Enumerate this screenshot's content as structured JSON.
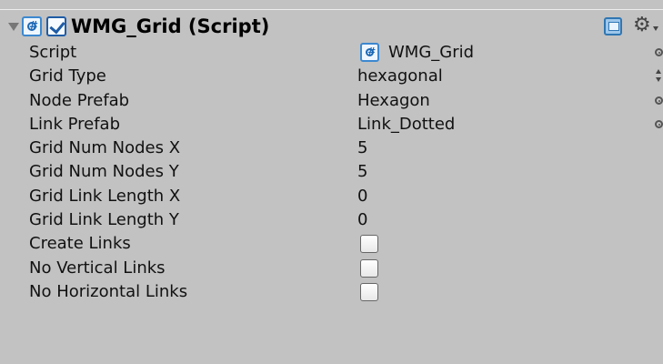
{
  "component": {
    "title": "WMG_Grid (Script)",
    "enabled": true,
    "icons": {
      "foldout": "foldout-expanded-icon",
      "script": "script-icon",
      "help": "help-icon",
      "settings": "gear-icon"
    }
  },
  "fields": [
    {
      "label": "Script",
      "value": "WMG_Grid",
      "type": "object-reference"
    },
    {
      "label": "Grid Type",
      "value": "hexagonal",
      "type": "enum"
    },
    {
      "label": "Node Prefab",
      "value": "Hexagon",
      "type": "object-reference"
    },
    {
      "label": "Link Prefab",
      "value": "Link_Dotted",
      "type": "object-reference"
    },
    {
      "label": "Grid Num Nodes X",
      "value": "5",
      "type": "int"
    },
    {
      "label": "Grid Num Nodes Y",
      "value": "5",
      "type": "int"
    },
    {
      "label": "Grid Link Length X",
      "value": "0",
      "type": "float"
    },
    {
      "label": "Grid Link Length Y",
      "value": "0",
      "type": "float"
    },
    {
      "label": "Create Links",
      "checked": false,
      "type": "bool"
    },
    {
      "label": "No Vertical Links",
      "checked": false,
      "type": "bool"
    },
    {
      "label": "No Horizontal Links",
      "checked": false,
      "type": "bool"
    }
  ]
}
